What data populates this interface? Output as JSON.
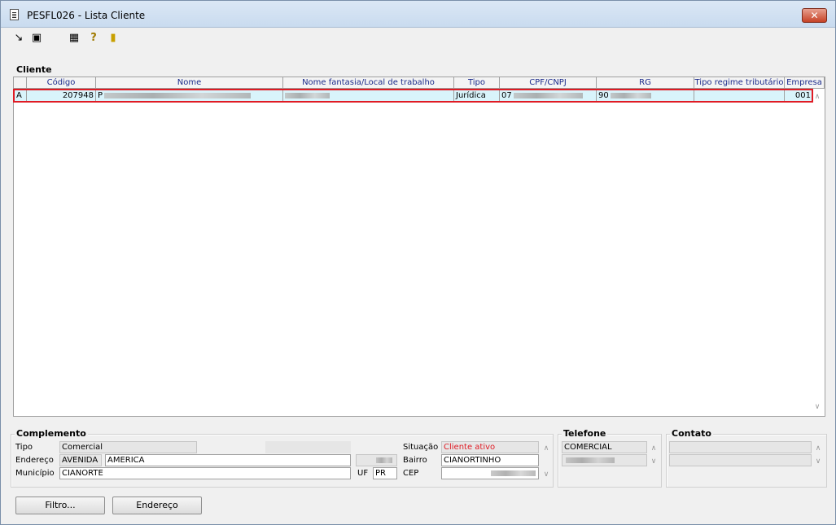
{
  "window": {
    "title": "PESFL026 - Lista Cliente",
    "close_label": "✕"
  },
  "cliente": {
    "label": "Cliente",
    "headers": [
      "Código",
      "Nome",
      "Nome fantasia/Local de trabalho",
      "Tipo",
      "CPF/CNPJ",
      "RG",
      "Tipo regime tributário",
      "Empresa"
    ],
    "rows": [
      {
        "status": "A",
        "codigo": "207948",
        "nome": "P",
        "fantasia": "",
        "tipo": "Jurídica",
        "cpf": "07",
        "rg": "90",
        "regime": "",
        "empresa": "001"
      }
    ]
  },
  "complemento": {
    "label": "Complemento",
    "tipo_label": "Tipo",
    "tipo_value": "Comercial",
    "endereco_label": "Endereço",
    "endereco_tipo": "AVENIDA",
    "endereco_value": "AMERICA",
    "municipio_label": "Município",
    "municipio_value": "CIANORTE",
    "uf_label": "UF",
    "uf_value": "PR",
    "situacao_label": "Situação",
    "situacao_value": "Cliente ativo",
    "bairro_label": "Bairro",
    "bairro_value": "CIANORTINHO",
    "cep_label": "CEP"
  },
  "telefone": {
    "label": "Telefone",
    "tipo_value": "COMERCIAL"
  },
  "contato": {
    "label": "Contato"
  },
  "buttons": {
    "filtro": "Filtro...",
    "endereco": "Endereço"
  },
  "colors": {
    "situacao": "#e01b24",
    "selection": "#d9f4fb",
    "highlight": "#e01b24",
    "header_text": "#1a2a8a"
  }
}
